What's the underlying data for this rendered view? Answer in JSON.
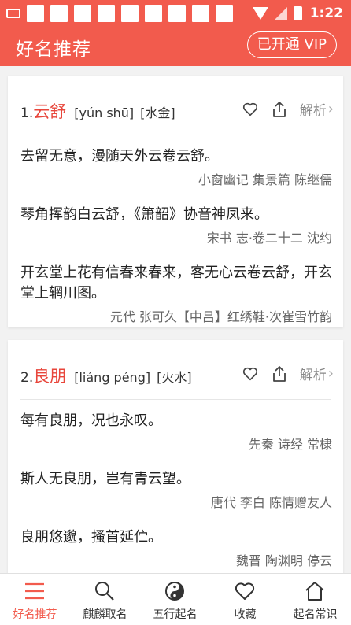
{
  "status_bar": {
    "time": "1:22"
  },
  "header": {
    "title": "好名推荐",
    "vip_button": "已开通 VIP"
  },
  "cards": [
    {
      "index": "1.",
      "name": "云舒",
      "pinyin": "[yún shū]",
      "wuxing": "[水金]",
      "parse_label": "解析",
      "poems": [
        {
          "text": "去留无意，漫随天外云卷云舒。",
          "source": "小窗幽记 集景篇 陈继儒"
        },
        {
          "text": "琴角挥韵白云舒，《箫韶》协音神凤来。",
          "source": "宋书 志·卷二十二 沈约"
        },
        {
          "text": "开玄堂上花有信春来春来，客无心云卷云舒，开玄堂上辋川图。",
          "source": "元代 张可久【中吕】红绣鞋·次崔雪竹韵"
        }
      ]
    },
    {
      "index": "2.",
      "name": "良朋",
      "pinyin": "[liáng péng]",
      "wuxing": "[火水]",
      "parse_label": "解析",
      "poems": [
        {
          "text": "每有良朋，况也永叹。",
          "source": "先秦 诗经 常棣"
        },
        {
          "text": "斯人无良朋，岂有青云望。",
          "source": "唐代 李白 陈情赠友人"
        },
        {
          "text": "良朋悠邈，搔首延伫。",
          "source": "魏晋 陶渊明 停云"
        }
      ]
    }
  ],
  "tabbar": {
    "items": [
      {
        "label": "好名推荐",
        "icon": "list-icon",
        "active": true
      },
      {
        "label": "麒麟取名",
        "icon": "search-icon",
        "active": false
      },
      {
        "label": "五行起名",
        "icon": "yin-yang-icon",
        "active": false
      },
      {
        "label": "收藏",
        "icon": "heart-icon",
        "active": false
      },
      {
        "label": "起名常识",
        "icon": "home-icon",
        "active": false
      }
    ]
  },
  "colors": {
    "brand": "#f25b4d",
    "name_red": "#e8463b"
  }
}
